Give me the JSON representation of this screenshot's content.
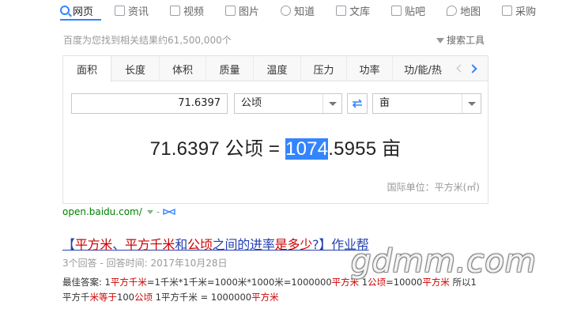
{
  "nav": {
    "items": [
      {
        "label": "网页",
        "icon": "search-icon"
      },
      {
        "label": "资讯",
        "icon": "news-icon"
      },
      {
        "label": "视频",
        "icon": "video-icon"
      },
      {
        "label": "图片",
        "icon": "image-icon"
      },
      {
        "label": "知道",
        "icon": "question-icon"
      },
      {
        "label": "文库",
        "icon": "library-icon"
      },
      {
        "label": "贴吧",
        "icon": "tieba-icon"
      },
      {
        "label": "地图",
        "icon": "map-icon"
      },
      {
        "label": "采购",
        "icon": "shopping-icon"
      }
    ],
    "active_index": 0
  },
  "results": {
    "count_text": "百度为您找到相关结果约61,500,000个",
    "tools_label": "搜索工具"
  },
  "converter": {
    "tabs": [
      "面积",
      "长度",
      "体积",
      "质量",
      "温度",
      "压力",
      "功率",
      "功/能/热"
    ],
    "active_tab": 0,
    "input_value": "71.6397",
    "from_unit": "公顷",
    "to_unit": "亩",
    "result": {
      "prefix": "71.6397 公顷 = ",
      "highlight": "1074",
      "suffix": ".5955 亩"
    },
    "intl_unit": "国际单位：平方米(㎡)"
  },
  "source_url": "open.baidu.com/",
  "search_result": {
    "title_parts": [
      {
        "t": "【",
        "red": false
      },
      {
        "t": "平方米",
        "red": true
      },
      {
        "t": "、",
        "red": false
      },
      {
        "t": "平方千米",
        "red": true
      },
      {
        "t": "和",
        "red": false
      },
      {
        "t": "公顷",
        "red": true
      },
      {
        "t": "之间的进率",
        "red": false
      },
      {
        "t": "是多少",
        "red": true
      },
      {
        "t": "?】作业帮",
        "red": false
      }
    ],
    "meta": "3个回答 - 回答时间: 2017年10月28日",
    "answer_line1": [
      {
        "t": "最佳答案: 1",
        "red": false
      },
      {
        "t": "平方千米",
        "red": true
      },
      {
        "t": "=1千米*1千米=1000米*1000米=1000000",
        "red": false
      },
      {
        "t": "平方米",
        "red": true
      },
      {
        "t": " 1",
        "red": false
      },
      {
        "t": "公顷",
        "red": true
      },
      {
        "t": "=10000",
        "red": false
      },
      {
        "t": "平方米",
        "red": true
      },
      {
        "t": " 所以1",
        "red": false
      }
    ],
    "answer_line2": [
      {
        "t": "平方千",
        "red": false
      },
      {
        "t": "米等于",
        "red": true
      },
      {
        "t": "100",
        "red": false
      },
      {
        "t": "公顷",
        "red": true
      },
      {
        "t": " 1平方千米 = 1000000",
        "red": false
      },
      {
        "t": "平方米",
        "red": true
      }
    ]
  },
  "watermark": "gdmm.com"
}
